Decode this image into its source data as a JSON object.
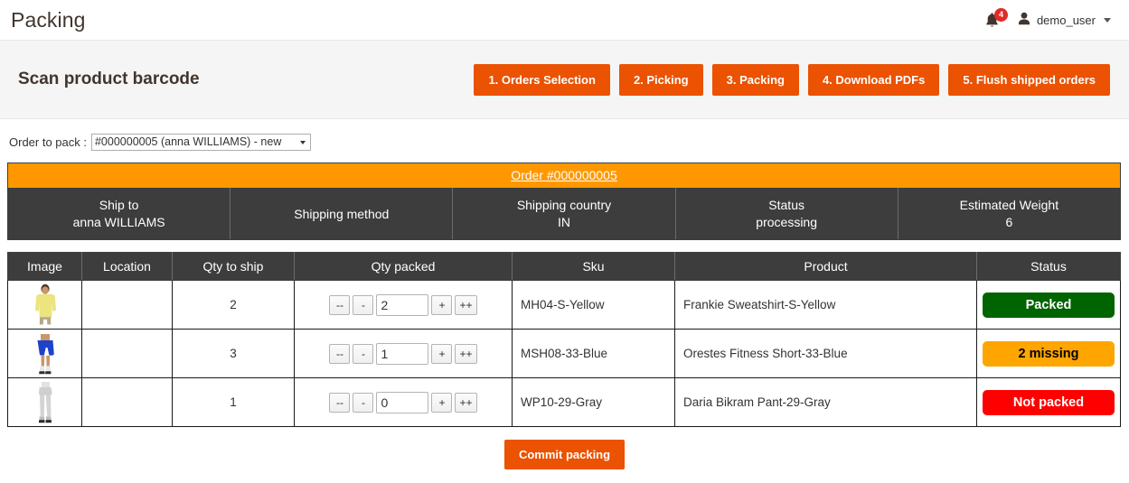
{
  "header": {
    "page_title": "Packing",
    "notification_icon": "bell-icon",
    "notification_count": "4",
    "user_icon": "user-icon",
    "user_name": "demo_user",
    "caret_icon": "chevron-down-icon"
  },
  "scan_panel": {
    "title": "Scan product barcode",
    "nav_buttons": [
      {
        "label": "1. Orders Selection"
      },
      {
        "label": "2. Picking"
      },
      {
        "label": "3. Packing"
      },
      {
        "label": "4. Download PDFs"
      },
      {
        "label": "5. Flush shipped orders"
      }
    ]
  },
  "order_selector": {
    "label": "Order to pack :",
    "selected": "#000000005 (anna WILLIAMS) - new",
    "options": [
      "#000000005 (anna WILLIAMS) - new"
    ]
  },
  "order_summary": {
    "banner_link": "Order #000000005",
    "fields": [
      {
        "label": "Ship to",
        "value": "anna WILLIAMS"
      },
      {
        "label": "Shipping method",
        "value": ""
      },
      {
        "label": "Shipping country",
        "value": "IN"
      },
      {
        "label": "Status",
        "value": "processing"
      },
      {
        "label": "Estimated Weight",
        "value": "6"
      }
    ]
  },
  "items_table": {
    "columns": [
      "Image",
      "Location",
      "Qty to ship",
      "Qty packed",
      "Sku",
      "Product",
      "Status"
    ],
    "stepper_labels": {
      "minus_minus": "--",
      "minus": "-",
      "plus": "+",
      "plus_plus": "++"
    },
    "rows": [
      {
        "image_alt": "yellow-sweatshirt-thumbnail",
        "location": "",
        "qty_to_ship": "2",
        "qty_packed": "2",
        "sku": "MH04-S-Yellow",
        "product": "Frankie Sweatshirt-S-Yellow",
        "status": "Packed",
        "status_color": "#006400"
      },
      {
        "image_alt": "blue-shorts-thumbnail",
        "location": "",
        "qty_to_ship": "3",
        "qty_packed": "1",
        "sku": "MSH08-33-Blue",
        "product": "Orestes Fitness Short-33-Blue",
        "status": "2 missing",
        "status_color": "#ffa500"
      },
      {
        "image_alt": "gray-pant-thumbnail",
        "location": "",
        "qty_to_ship": "1",
        "qty_packed": "0",
        "sku": "WP10-29-Gray",
        "product": "Daria Bikram Pant-29-Gray",
        "status": "Not packed",
        "status_color": "#ff0000"
      }
    ]
  },
  "footer": {
    "commit_label": "Commit packing"
  },
  "colors": {
    "accent_orange": "#eb5202",
    "banner_orange": "#ff9800",
    "dark_header": "#3d3d3d",
    "badge_red": "#e02b27"
  }
}
